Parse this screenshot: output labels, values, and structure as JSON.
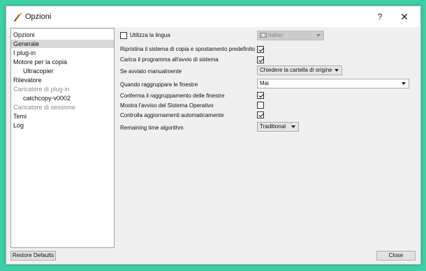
{
  "window": {
    "title": "Opzioni",
    "help_glyph": "?",
    "close_glyph": "✕"
  },
  "sidebar": {
    "items": [
      {
        "label": "Opzioni"
      },
      {
        "label": "Generale"
      },
      {
        "label": "I plug-in"
      },
      {
        "label": "Motore per la copia"
      },
      {
        "label": "Ultracopier"
      },
      {
        "label": "Rilevatore"
      },
      {
        "label": "Caricatore di plug-in"
      },
      {
        "label": "catchcopy-v0002"
      },
      {
        "label": "Caricatore di sessione"
      },
      {
        "label": "Temi"
      },
      {
        "label": "Log"
      }
    ]
  },
  "buttons": {
    "restore_defaults": "Restore Defaults",
    "close": "Close"
  },
  "settings": {
    "use_language": {
      "label": "Utilizza la lingua",
      "checked": false
    },
    "language_combo": {
      "value": "Italian",
      "icon": "flag-icon",
      "enabled": false
    },
    "restore_copy_system": {
      "label": "Ripristina il sistema di copia e spostamento predefinito",
      "checked": true
    },
    "load_at_startup": {
      "label": "Carica il programma all'avvio di sistema",
      "checked": true
    },
    "manual_start": {
      "label": "Se avviato manualmente",
      "value": "Chiedere la cartella di origine"
    },
    "group_windows": {
      "label": "Quando raggruppare le finestre",
      "value": "Mai"
    },
    "confirm_grouping": {
      "label": "Conferma il raggruppamento delle finestre",
      "checked": true
    },
    "show_os_warning": {
      "label": "Mostra l'avviso del Sistema Operativo",
      "checked": false
    },
    "check_updates": {
      "label": "Controlla aggiornamenti automaticamente",
      "checked": true
    },
    "remaining_time": {
      "label": "Remaining time algorithm",
      "value": "Traditional"
    }
  },
  "colors": {
    "background": "#3dd0a4",
    "selection": "#d9d9d9"
  }
}
